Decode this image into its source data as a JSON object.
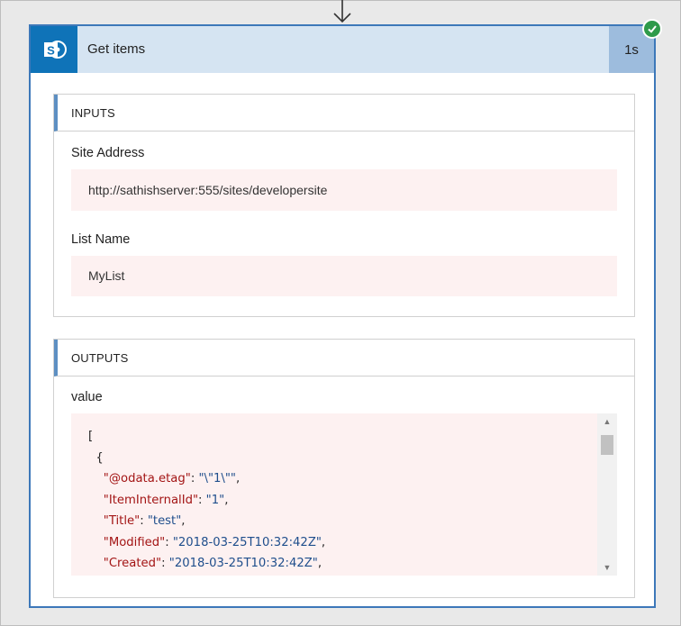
{
  "card": {
    "title": "Get items",
    "duration": "1s",
    "status_color": "#2e9a4a",
    "accent_color": "#3d78b9",
    "connector_icon": "sharepoint-icon"
  },
  "inputs": {
    "heading": "INPUTS",
    "site_address_label": "Site Address",
    "site_address_value": "http://sathishserver:555/sites/developersite",
    "list_name_label": "List Name",
    "list_name_value": "MyList"
  },
  "outputs": {
    "heading": "OUTPUTS",
    "value_label": "value",
    "json_open_bracket": "[",
    "json_open_brace": "{",
    "rows": [
      {
        "key": "\"@odata.etag\"",
        "value": "\"\\\"1\\\"\""
      },
      {
        "key": "\"ItemInternalId\"",
        "value": "\"1\""
      },
      {
        "key": "\"Title\"",
        "value": "\"test\""
      },
      {
        "key": "\"Modified\"",
        "value": "\"2018-03-25T10:32:42Z\""
      },
      {
        "key": "\"Created\"",
        "value": "\"2018-03-25T10:32:42Z\""
      }
    ]
  }
}
